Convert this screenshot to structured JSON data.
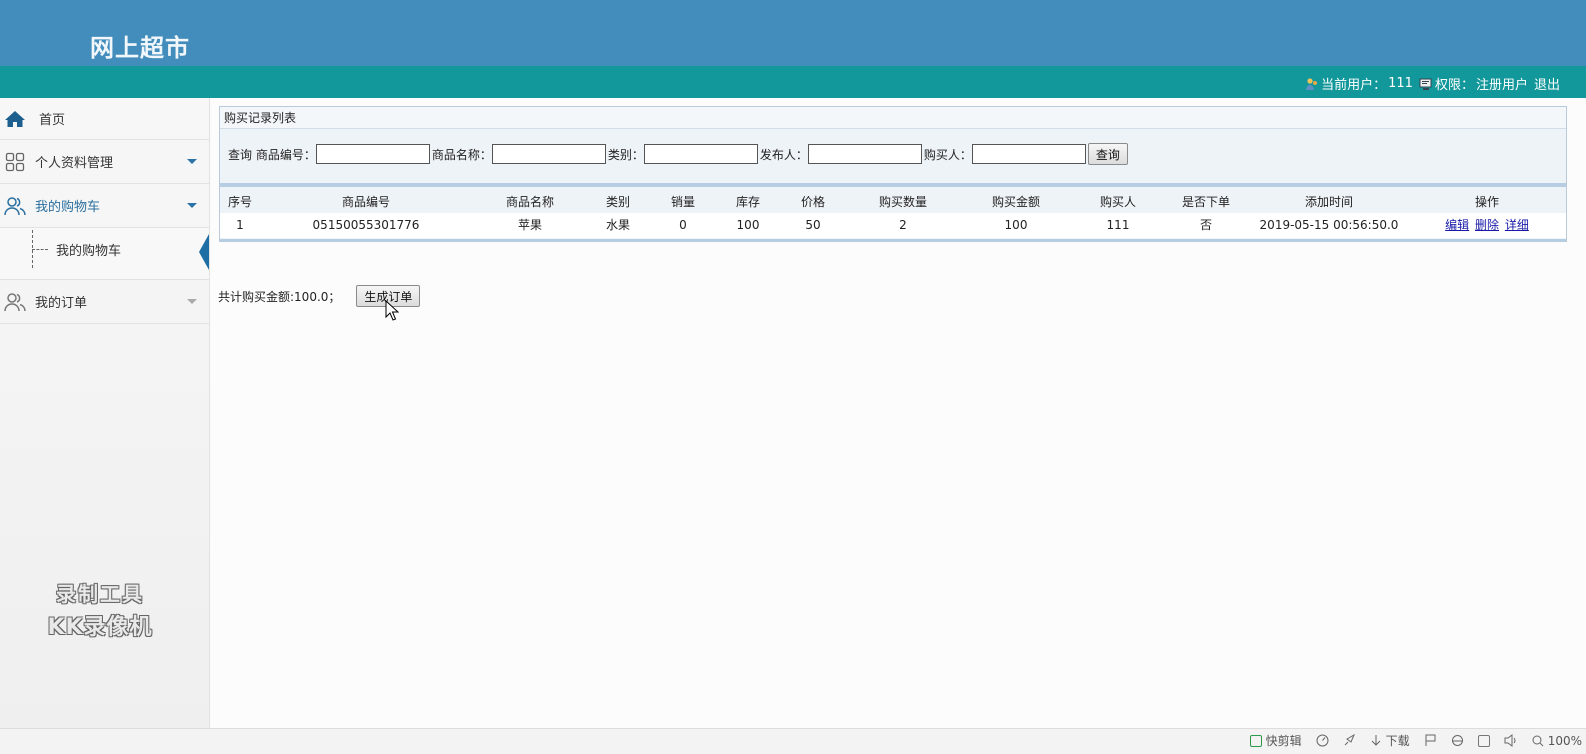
{
  "header": {
    "site_title": "网上超市",
    "current_user_label": "当前用户：",
    "current_user": "111",
    "role_label": "权限：",
    "role": "注册用户",
    "logout": "退出"
  },
  "sidebar": {
    "items": [
      {
        "label": "首页",
        "icon": "home-icon"
      },
      {
        "label": "个人资料管理",
        "icon": "grid-icon"
      },
      {
        "label": "我的购物车",
        "icon": "users-icon"
      },
      {
        "label": "我的订单",
        "icon": "users-icon"
      }
    ],
    "submenu": [
      {
        "label": "我的购物车"
      }
    ],
    "watermark": [
      "录制工具",
      "KK录像机"
    ]
  },
  "panel": {
    "title": "购买记录列表",
    "query": {
      "prefix": "查询",
      "code_label": "商品编号：",
      "name_label": "商品名称：",
      "category_label": "类别：",
      "publisher_label": "发布人：",
      "buyer_label": "购买人：",
      "code_value": "",
      "name_value": "",
      "category_value": "",
      "publisher_value": "",
      "buyer_value": "",
      "button": "查询"
    },
    "table": {
      "columns": [
        "序号",
        "商品编号",
        "商品名称",
        "类别",
        "销量",
        "库存",
        "价格",
        "购买数量",
        "购买金额",
        "购买人",
        "是否下单",
        "添加时间",
        "操作"
      ],
      "rows": [
        {
          "cells": [
            "1",
            "05150055301776",
            "苹果",
            "水果",
            "0",
            "100",
            "50",
            "2",
            "100",
            "111",
            "否",
            "2019-05-15 00:56:50.0"
          ],
          "ops": [
            "编辑",
            "删除",
            "详细"
          ]
        }
      ]
    }
  },
  "summary": {
    "total_text": "共计购买金额:100.0；",
    "generate_button": "生成订单"
  },
  "statusbar": {
    "items": [
      "快剪辑",
      "下载",
      "100%"
    ]
  },
  "colors": {
    "header_bg": "#428dbb",
    "userbar_bg": "#12979a",
    "sidebar_accent": "#1d6ea4",
    "link": "#1a1aa8"
  }
}
